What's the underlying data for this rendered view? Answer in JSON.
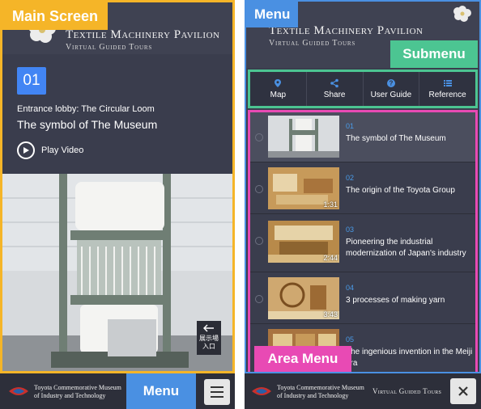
{
  "left": {
    "tag_main": "Main Screen",
    "pavilion_title": "Textile Machinery Pavilion",
    "pavilion_sub": "Virtual Guided Tours",
    "spot_number": "01",
    "subtitle": "Entrance lobby: The Circular Loom",
    "headline": "The symbol of The Museum",
    "play_label": "Play Video",
    "sign_text": "展示場\n入口",
    "museum_line1": "Toyota Commemorative Museum",
    "museum_line2": "of Industry and Technology",
    "tag_menu": "Menu"
  },
  "right": {
    "tag_menu": "Menu",
    "pavilion_title": "Textile Machinery Pavilion",
    "pavilion_sub": "Virtual Guided Tours",
    "tag_submenu": "Submenu",
    "submenu": [
      {
        "icon": "map-pin-icon",
        "label": "Map"
      },
      {
        "icon": "share-icon",
        "label": "Share"
      },
      {
        "icon": "help-icon",
        "label": "User Guide"
      },
      {
        "icon": "list-icon",
        "label": "Reference"
      }
    ],
    "items": [
      {
        "num": "01",
        "title": "The symbol of The Museum",
        "duration": ""
      },
      {
        "num": "02",
        "title": "The origin of the Toyota Group",
        "duration": "1:31"
      },
      {
        "num": "03",
        "title": "Pioneering the industrial modernization of Japan's industry",
        "duration": "2:44"
      },
      {
        "num": "04",
        "title": "3 processes of making yarn",
        "duration": "3:43"
      },
      {
        "num": "05",
        "title": "The ingenious invention in the Meiji era",
        "duration": ""
      }
    ],
    "tag_area": "Area Menu",
    "museum_line1": "Toyota Commemorative Museum",
    "museum_line2": "of Industry and Technology",
    "vg_label": "Virtual Guided Tours"
  },
  "colors": {
    "main_accent": "#f5b528",
    "menu_accent": "#4a90e2",
    "submenu_accent": "#4cc592",
    "area_accent": "#e84ab4",
    "number_blue": "#4285f4"
  }
}
